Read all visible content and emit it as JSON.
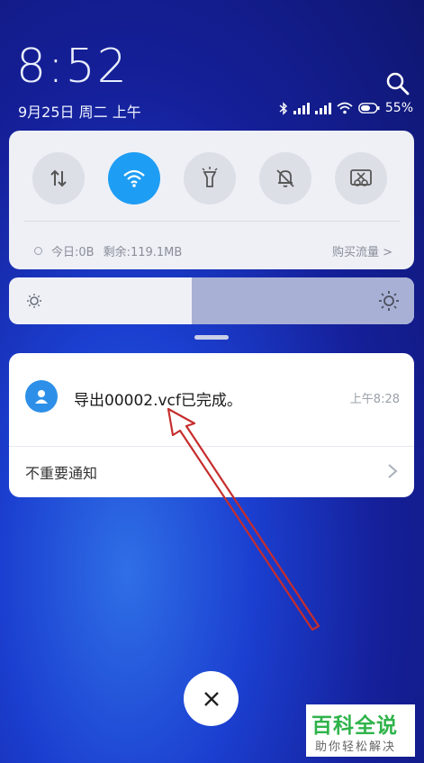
{
  "lockscreen": {
    "time": "8:52",
    "date": "9月25日 周二 上午",
    "battery_percent": "55%",
    "search_icon": "search-icon"
  },
  "quick_settings": {
    "tiles": [
      {
        "name": "data",
        "icon": "data-transfer-icon",
        "active": false
      },
      {
        "name": "wifi",
        "icon": "wifi-icon",
        "active": true
      },
      {
        "name": "flashlight",
        "icon": "flashlight-icon",
        "active": false
      },
      {
        "name": "mute",
        "icon": "bell-off-icon",
        "active": false
      },
      {
        "name": "screenshot",
        "icon": "screenshot-icon",
        "active": false
      }
    ],
    "today_usage": "今日:0B",
    "remaining": "剩余:119.1MB",
    "buy_data": "购买流量 >",
    "active_color": "#1e9df4"
  },
  "brightness": {
    "level_percent": 45
  },
  "notification": {
    "app_icon": "contact-icon",
    "title": "导出00002.vcf已完成。",
    "time": "上午8:28",
    "footer_label": "不重要通知"
  },
  "watermark": {
    "main": "百科全说",
    "sub": "助你轻松解决"
  }
}
